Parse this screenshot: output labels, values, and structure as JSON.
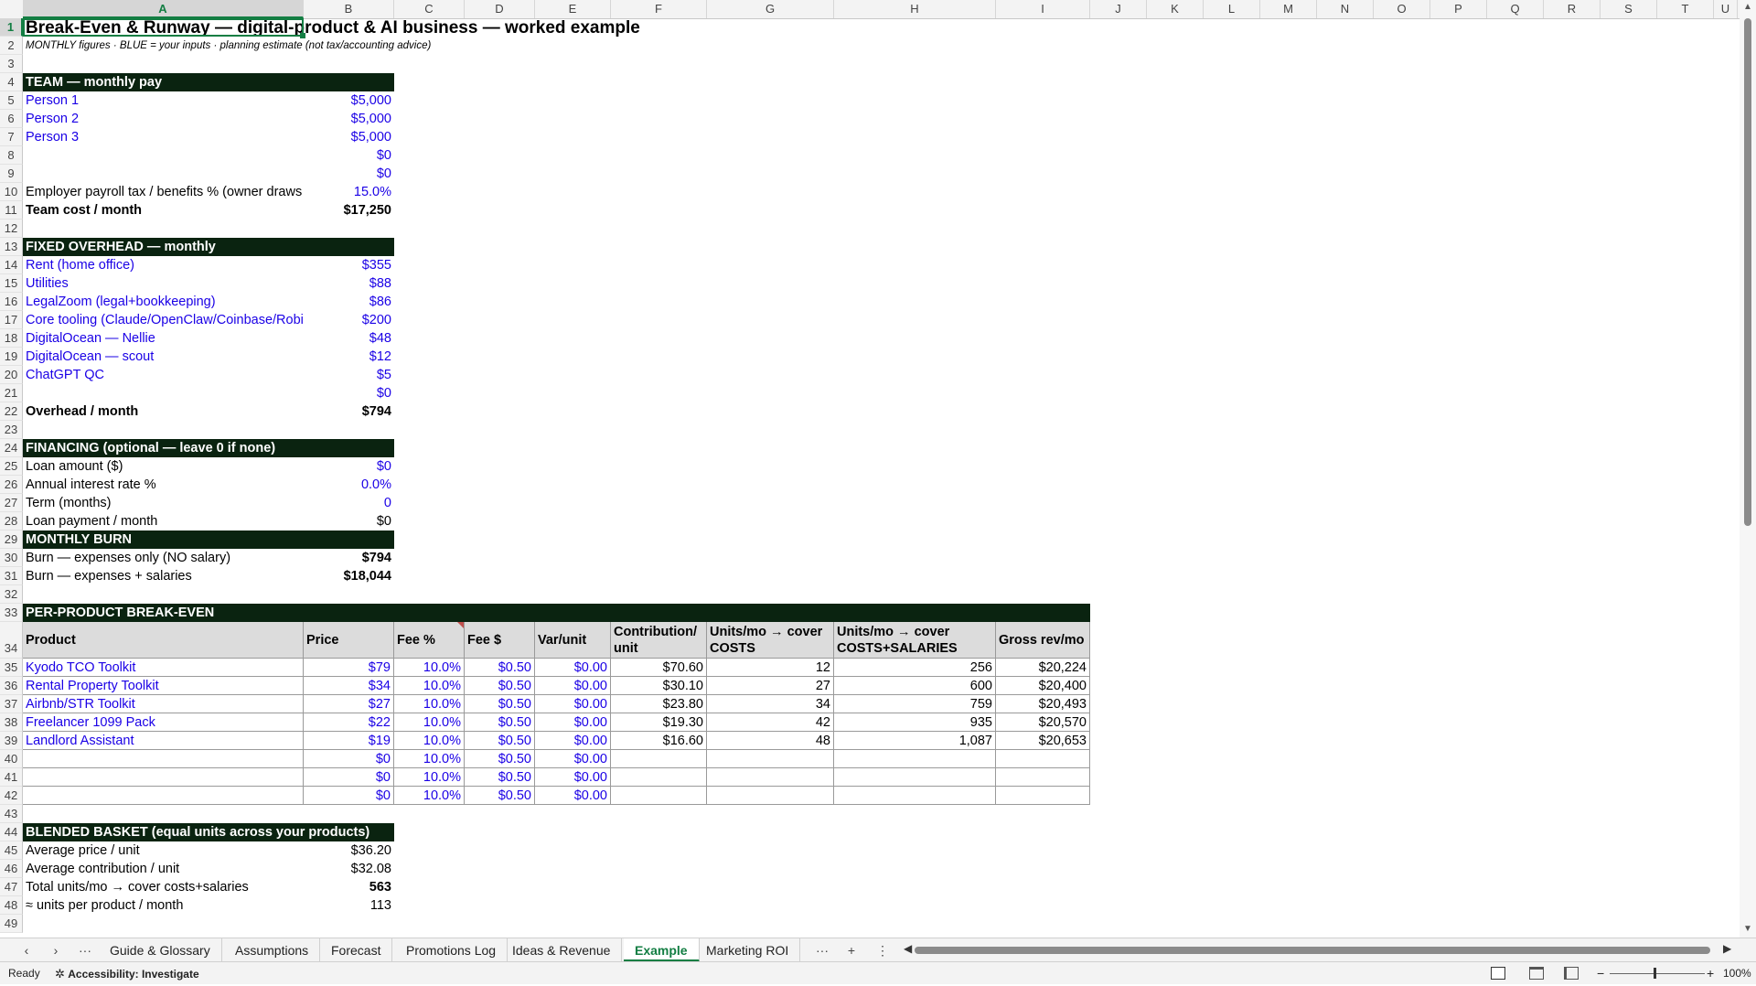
{
  "sheet": {
    "columns": [
      "A",
      "B",
      "C",
      "D",
      "E",
      "F",
      "G",
      "H",
      "I",
      "J",
      "K",
      "L",
      "M",
      "N",
      "O",
      "P",
      "Q",
      "R",
      "S",
      "T",
      "U"
    ],
    "selected_cell": "A1",
    "title": "Break-Even & Runway — digital-product & AI business — worked example",
    "subtitle": "MONTHLY figures · BLUE = your inputs · planning estimate (not tax/accounting advice)",
    "team": {
      "banner": "TEAM — monthly pay",
      "rows": [
        {
          "label": "Person 1",
          "value": "$5,000"
        },
        {
          "label": "Person 2",
          "value": "$5,000"
        },
        {
          "label": "Person 3",
          "value": "$5,000"
        },
        {
          "label": "",
          "value": "$0"
        },
        {
          "label": "",
          "value": "$0"
        }
      ],
      "tax_label": "Employer payroll tax / benefits %  (owner draws",
      "tax_value": "15.0%",
      "total_label": "Team cost / month",
      "total_value": "$17,250"
    },
    "overhead": {
      "banner": "FIXED OVERHEAD — monthly",
      "rows": [
        {
          "label": "Rent (home office)",
          "value": "$355"
        },
        {
          "label": "Utilities",
          "value": "$88"
        },
        {
          "label": "LegalZoom (legal+bookkeeping)",
          "value": "$86"
        },
        {
          "label": "Core tooling (Claude/OpenClaw/Coinbase/Robi",
          "value": "$200"
        },
        {
          "label": "DigitalOcean — Nellie",
          "value": "$48"
        },
        {
          "label": "DigitalOcean — scout",
          "value": "$12"
        },
        {
          "label": "ChatGPT QC",
          "value": "$5"
        },
        {
          "label": "",
          "value": "$0"
        }
      ],
      "total_label": "Overhead / month",
      "total_value": "$794"
    },
    "financing": {
      "banner": "FINANCING (optional — leave 0 if none)",
      "rows": [
        {
          "label": "Loan amount ($)",
          "value": "$0",
          "input": true
        },
        {
          "label": "Annual interest rate %",
          "value": "0.0%",
          "input": true
        },
        {
          "label": "Term (months)",
          "value": "0",
          "input": true
        },
        {
          "label": "Loan payment / month",
          "value": "$0",
          "input": false
        }
      ]
    },
    "burn": {
      "banner": "MONTHLY BURN",
      "rows": [
        {
          "label": "Burn — expenses only (NO salary)",
          "value": "$794"
        },
        {
          "label": "Burn — expenses + salaries",
          "value": "$18,044"
        }
      ]
    },
    "per_product": {
      "banner": "PER-PRODUCT BREAK-EVEN",
      "headers": [
        {
          "l1": "Product",
          "l2": ""
        },
        {
          "l1": "Price",
          "l2": ""
        },
        {
          "l1": "Fee %",
          "l2": ""
        },
        {
          "l1": "Fee $",
          "l2": ""
        },
        {
          "l1": "Var/unit",
          "l2": ""
        },
        {
          "l1": "Contribution/",
          "l2": "unit"
        },
        {
          "l1": "Units/mo → cover",
          "l2": "COSTS"
        },
        {
          "l1": "Units/mo → cover",
          "l2": "COSTS+SALARIES"
        },
        {
          "l1": "Gross rev/mo",
          "l2": ""
        }
      ],
      "rows": [
        [
          "Kyodo TCO Toolkit",
          "$79",
          "10.0%",
          "$0.50",
          "$0.00",
          "$70.60",
          "12",
          "256",
          "$20,224"
        ],
        [
          "Rental Property Toolkit",
          "$34",
          "10.0%",
          "$0.50",
          "$0.00",
          "$30.10",
          "27",
          "600",
          "$20,400"
        ],
        [
          "Airbnb/STR Toolkit",
          "$27",
          "10.0%",
          "$0.50",
          "$0.00",
          "$23.80",
          "34",
          "759",
          "$20,493"
        ],
        [
          "Freelancer 1099 Pack",
          "$22",
          "10.0%",
          "$0.50",
          "$0.00",
          "$19.30",
          "42",
          "935",
          "$20,570"
        ],
        [
          "Landlord Assistant",
          "$19",
          "10.0%",
          "$0.50",
          "$0.00",
          "$16.60",
          "48",
          "1,087",
          "$20,653"
        ],
        [
          "",
          "$0",
          "10.0%",
          "$0.50",
          "$0.00",
          "",
          "",
          "",
          ""
        ],
        [
          "",
          "$0",
          "10.0%",
          "$0.50",
          "$0.00",
          "",
          "",
          "",
          ""
        ],
        [
          "",
          "$0",
          "10.0%",
          "$0.50",
          "$0.00",
          "",
          "",
          "",
          ""
        ]
      ]
    },
    "blended": {
      "banner": "BLENDED BASKET (equal units across your products)",
      "rows": [
        {
          "label": "Average price / unit",
          "value": "$36.20",
          "bold": false
        },
        {
          "label": "Average contribution / unit",
          "value": "$32.08",
          "bold": false
        },
        {
          "label": "Total units/mo → cover costs+salaries",
          "value": "563",
          "bold": true
        },
        {
          "label": "≈ units per product / month",
          "value": "113",
          "bold": false
        }
      ]
    }
  },
  "tabs": {
    "items": [
      "Guide & Glossary",
      "Assumptions",
      "Forecast",
      "Promotions Log",
      "Ideas & Revenue",
      "Example",
      "Marketing ROI"
    ],
    "active": "Example",
    "more": "···",
    "add": "+",
    "menu": "⋮"
  },
  "status": {
    "ready": "Ready",
    "accessibility": "Accessibility: Investigate",
    "zoom": "100%"
  }
}
